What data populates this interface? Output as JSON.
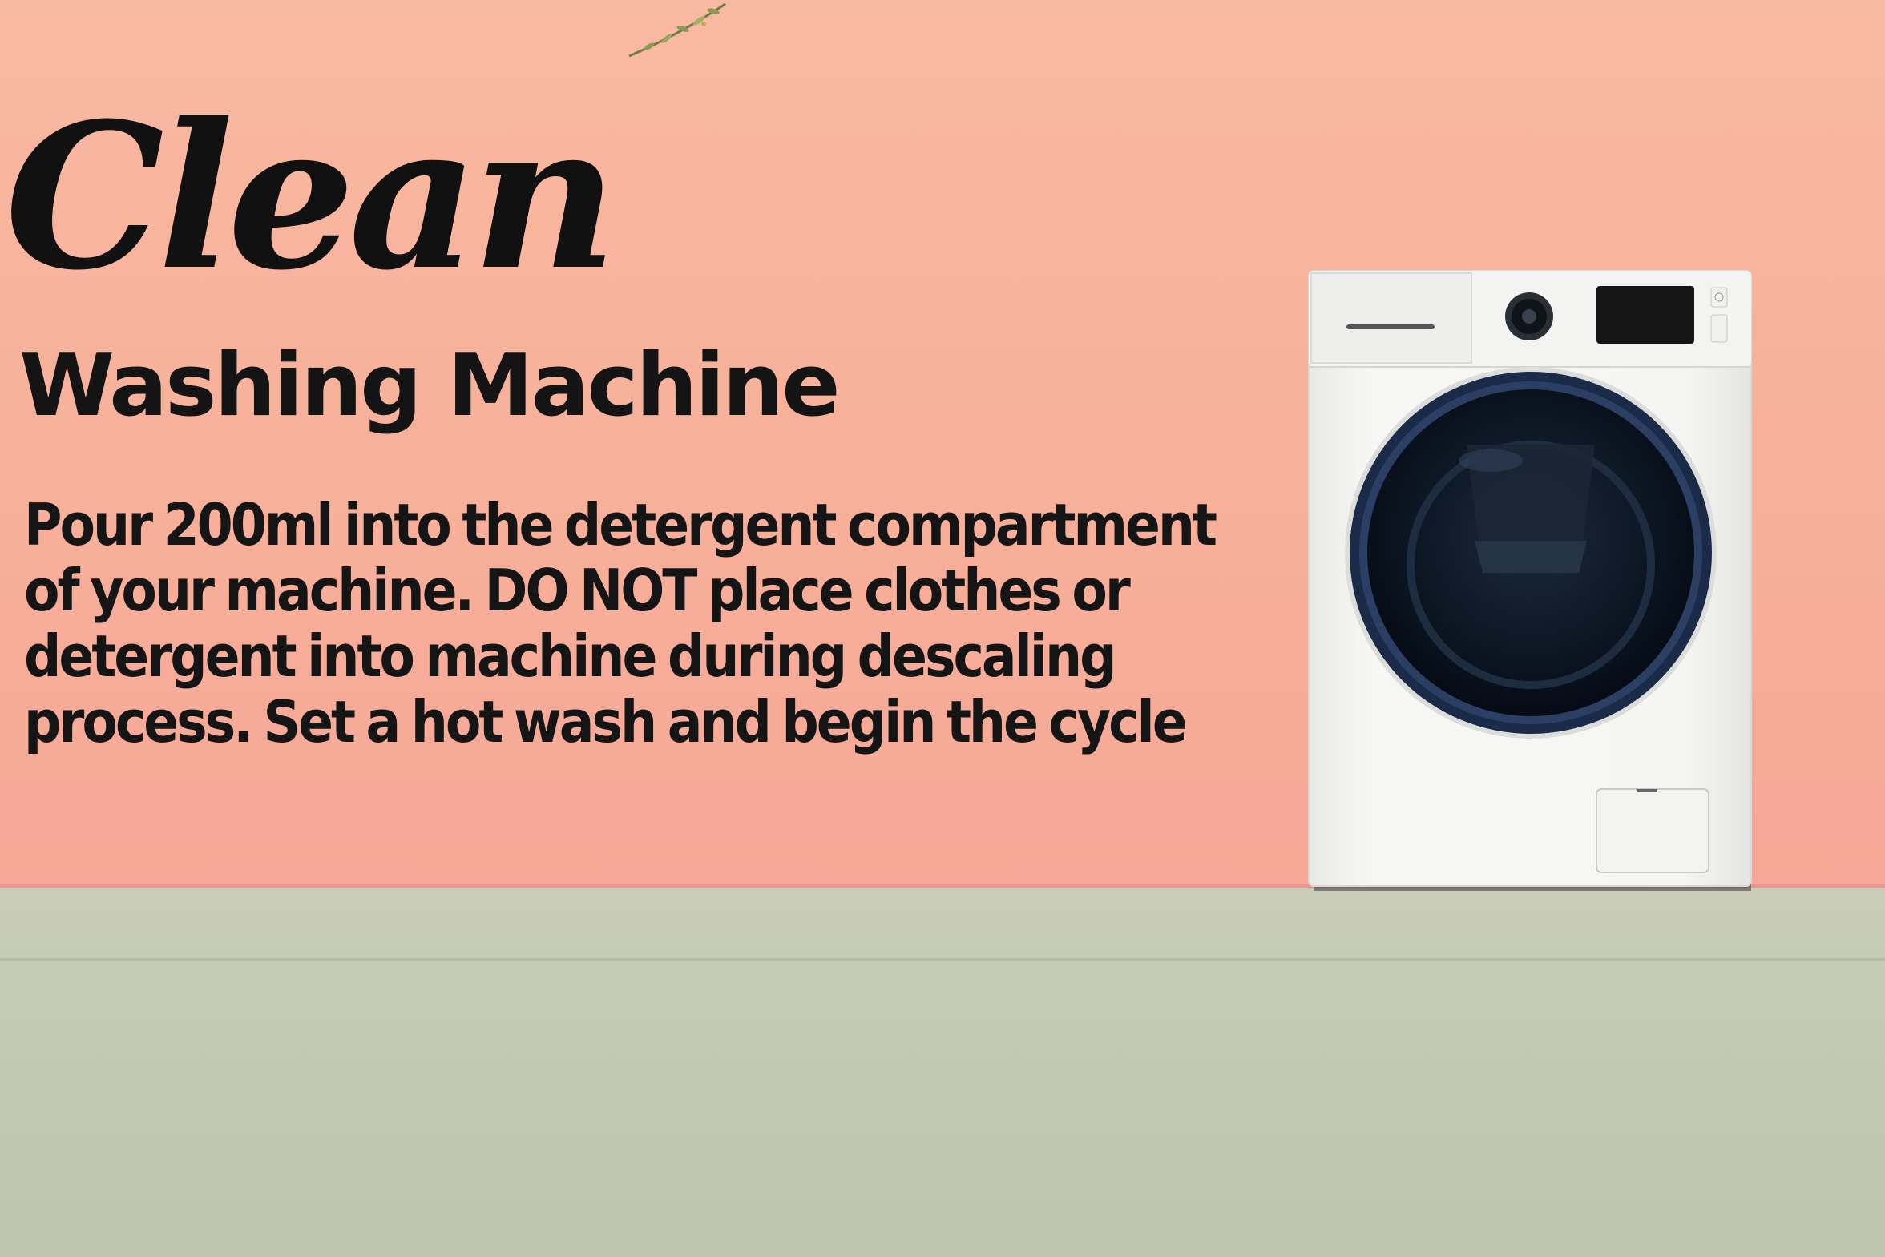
{
  "heading": {
    "title": "Clean",
    "subtitle": "Washing Machine"
  },
  "body_text": "Pour 200ml into the detergent compartment of your machine. DO NOT place clothes or detergent into machine during descaling process. Set a hot wash and begin the cycle",
  "colors": {
    "wall": "#f7b09a",
    "floor": "#c3c9b4",
    "skirting": "#ec9592",
    "text": "#111111",
    "washer_body": "#f4f4f2",
    "door_glass": "#0d1a2b"
  },
  "illustration": {
    "washer": "washing-machine-icon",
    "plant": "plant-sprig-icon"
  }
}
